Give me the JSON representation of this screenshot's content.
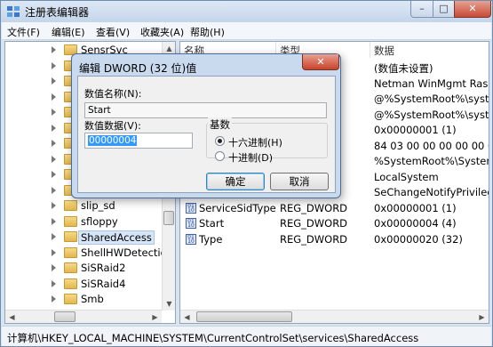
{
  "window": {
    "title": "注册表编辑器",
    "minimize": "–",
    "maximize": "□",
    "close": "✕"
  },
  "menu": [
    "文件(F)",
    "编辑(E)",
    "查看(V)",
    "收藏夹(A)",
    "帮助(H)"
  ],
  "tree": {
    "items": [
      {
        "label": "SensrSvc"
      },
      {
        "label": ""
      },
      {
        "label": ""
      },
      {
        "label": ""
      },
      {
        "label": ""
      },
      {
        "label": ""
      },
      {
        "label": ""
      },
      {
        "label": ""
      },
      {
        "label": ""
      },
      {
        "label": ""
      },
      {
        "label": "slip_sd"
      },
      {
        "label": "sfloppy"
      },
      {
        "label": "SharedAccess",
        "selected": true
      },
      {
        "label": "ShellHWDetection"
      },
      {
        "label": "SiSRaid2"
      },
      {
        "label": "SiSRaid4"
      },
      {
        "label": "Smb"
      }
    ]
  },
  "list": {
    "columns": [
      "名称",
      "类型",
      "数据"
    ],
    "rows": [
      {
        "name": "",
        "type": "",
        "data": "(数值未设置)"
      },
      {
        "name": "",
        "type": "Z",
        "data": "Netman WinMgmt RasM"
      },
      {
        "name": "",
        "type": "",
        "data": "@%SystemRoot%\\system"
      },
      {
        "name": "",
        "type": "",
        "data": "@%SystemRoot%\\system"
      },
      {
        "name": "",
        "type": "",
        "data": "0x00000001 (1)"
      },
      {
        "name": "",
        "type": "",
        "data": "84 03 00 00 00 00 00 00"
      },
      {
        "name": "",
        "type": "_SZ",
        "data": "%SystemRoot%\\System3"
      },
      {
        "name": "",
        "type": "",
        "data": "LocalSystem"
      },
      {
        "name": "",
        "type": "Z",
        "data": "SeChangeNotifyPrivilege"
      },
      {
        "name": "ServiceSidType",
        "type": "REG_DWORD",
        "data": "0x00000001 (1)"
      },
      {
        "name": "Start",
        "type": "REG_DWORD",
        "data": "0x00000004 (4)"
      },
      {
        "name": "Type",
        "type": "REG_DWORD",
        "data": "0x00000020 (32)"
      }
    ]
  },
  "status": "计算机\\HKEY_LOCAL_MACHINE\\SYSTEM\\CurrentControlSet\\services\\SharedAccess",
  "dialog": {
    "title": "编辑 DWORD (32 位)值",
    "close": "✕",
    "name_label": "数值名称(N):",
    "name_value": "Start",
    "data_label": "数值数据(V):",
    "data_value": "00000004",
    "base_label": "基数",
    "radio_hex": "十六进制(H)",
    "radio_dec": "十进制(D)",
    "ok": "确定",
    "cancel": "取消"
  }
}
